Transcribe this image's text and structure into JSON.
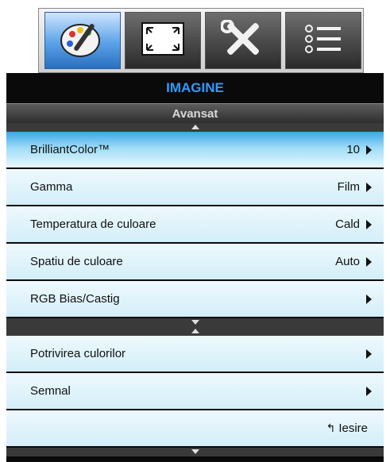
{
  "tabs": [
    {
      "name": "image-palette-icon"
    },
    {
      "name": "display-fullscreen-icon"
    },
    {
      "name": "setup-tools-icon"
    },
    {
      "name": "options-list-icon"
    }
  ],
  "menu": {
    "title": "IMAGINE",
    "subtitle": "Avansat",
    "items_top": [
      {
        "label": "BrilliantColor™",
        "value": "10"
      },
      {
        "label": "Gamma",
        "value": "Film"
      },
      {
        "label": "Temperatura de culoare",
        "value": "Cald"
      },
      {
        "label": "Spatiu de culoare",
        "value": "Auto"
      },
      {
        "label": "RGB Bias/Castig",
        "value": ""
      }
    ],
    "items_bottom": [
      {
        "label": "Potrivirea culorilor",
        "value": ""
      },
      {
        "label": "Semnal",
        "value": ""
      }
    ],
    "exit_label": "Iesire"
  }
}
